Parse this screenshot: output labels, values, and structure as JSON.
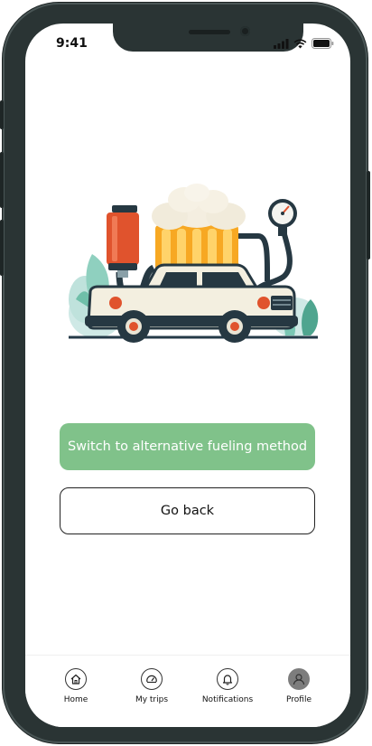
{
  "status_bar": {
    "time": "9:41",
    "icons": [
      "cellular-signal-icon",
      "wifi-icon",
      "battery-icon"
    ]
  },
  "illustration": {
    "subject": "car-fueling-with-beer-mug-illustration"
  },
  "actions": {
    "primary_label": "Switch to alternative fueling method",
    "secondary_label": "Go back"
  },
  "bottom_nav": {
    "items": [
      {
        "label": "Home",
        "icon": "home-icon"
      },
      {
        "label": "My trips",
        "icon": "speedometer-icon"
      },
      {
        "label": "Notifications",
        "icon": "bell-icon"
      },
      {
        "label": "Profile",
        "icon": "avatar-icon"
      }
    ]
  },
  "colors": {
    "primary_button": "#80c28a",
    "device_frame": "#2a3434",
    "text": "#111111"
  }
}
